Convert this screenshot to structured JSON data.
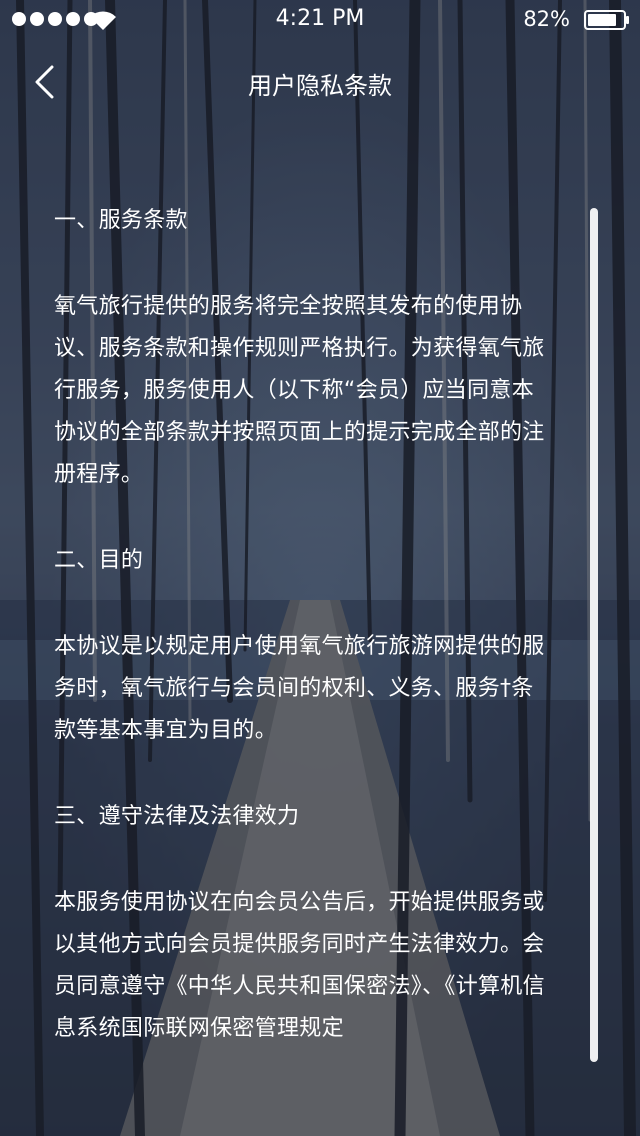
{
  "status_bar": {
    "time": "4:21 PM",
    "battery_percent": "82%",
    "signal_icon": "signal-dots-icon",
    "wifi_icon": "wifi-icon",
    "battery_icon": "battery-icon",
    "battery_level": 0.82
  },
  "nav": {
    "back_icon": "chevron-left-icon",
    "title": "用户隐私条款"
  },
  "sections": [
    {
      "title": "一、服务条款",
      "body": "氧气旅行提供的服务将完全按照其发布的使用协议、服务条款和操作规则严格执行。为获得氧气旅行服务，服务使用人（以下称“会员）应当同意本协议的全部条款并按照页面上的提示完成全部的注册程序。"
    },
    {
      "title": "二、目的",
      "body": "本协议是以规定用户使用氧气旅行旅游网提供的服务时，氧气旅行与会员间的权利、义务、服务†条款等基本事宜为目的。"
    },
    {
      "title": "三、遵守法律及法律效力",
      "body": "本服务使用协议在向会员公告后，开始提供服务或以其他方式向会员提供服务同时产生法律效力。会员同意遵守《中华人民共和国保密法》、《计算机信息系统国际联网保密管理规定"
    }
  ],
  "colors": {
    "text": "#ffffff",
    "overlay": "#14192d"
  }
}
